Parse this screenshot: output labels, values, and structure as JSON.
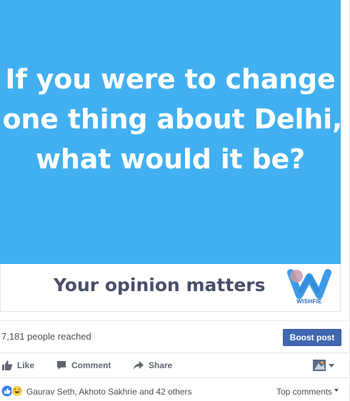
{
  "post": {
    "headline_lines": [
      "If you were to change",
      "one thing about Delhi,",
      "what would it be?"
    ],
    "tagline": "Your opinion matters",
    "brand_name": "WISHFIE",
    "image_bg": "#42b0f0"
  },
  "insights": {
    "reach_text": "7,181 people reached",
    "boost_label": "Boost post"
  },
  "actions": {
    "like_label": "Like",
    "comment_label": "Comment",
    "share_label": "Share"
  },
  "reactions": {
    "names_text": "Gaurav Seth, Akhoto Sakhrie and 42 others",
    "sort_label": "Top comments",
    "icons": [
      "like-reaction-icon",
      "haha-reaction-icon"
    ]
  },
  "colors": {
    "primary_button": "#4267b2",
    "text_secondary": "#606770"
  }
}
